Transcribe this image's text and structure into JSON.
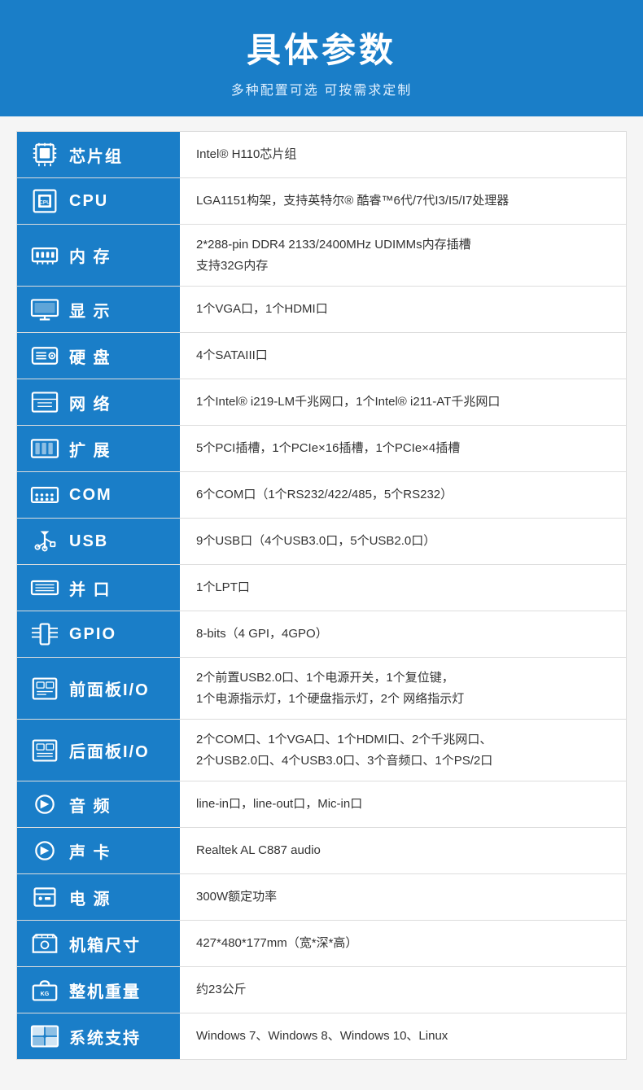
{
  "header": {
    "title": "具体参数",
    "subtitle": "多种配置可选 可按需求定制"
  },
  "rows": [
    {
      "id": "chipset",
      "icon": "chipset",
      "label": "芯片组",
      "value": "Intel® H110芯片组"
    },
    {
      "id": "cpu",
      "icon": "cpu",
      "label": "CPU",
      "value": "LGA1151构架，支持英特尔® 酷睿™6代/7代I3/I5/I7处理器"
    },
    {
      "id": "memory",
      "icon": "memory",
      "label": "内 存",
      "value": "2*288-pin DDR4 2133/2400MHz UDIMMs内存插槽\n支持32G内存"
    },
    {
      "id": "display",
      "icon": "display",
      "label": "显 示",
      "value": "1个VGA口，1个HDMI口"
    },
    {
      "id": "hdd",
      "icon": "hdd",
      "label": "硬 盘",
      "value": "4个SATAIII口"
    },
    {
      "id": "network",
      "icon": "network",
      "label": "网 络",
      "value": "1个Intel® i219-LM千兆网口，1个Intel® i211-AT千兆网口"
    },
    {
      "id": "expansion",
      "icon": "expansion",
      "label": "扩 展",
      "value": "5个PCI插槽，1个PCIe×16插槽，1个PCIe×4插槽"
    },
    {
      "id": "com",
      "icon": "com",
      "label": "COM",
      "value": "6个COM口（1个RS232/422/485，5个RS232）"
    },
    {
      "id": "usb",
      "icon": "usb",
      "label": "USB",
      "value": "9个USB口（4个USB3.0口，5个USB2.0口）"
    },
    {
      "id": "parallel",
      "icon": "parallel",
      "label": "并 口",
      "value": "1个LPT口"
    },
    {
      "id": "gpio",
      "icon": "gpio",
      "label": "GPIO",
      "value": "8-bits（4 GPI，4GPO）"
    },
    {
      "id": "frontio",
      "icon": "frontio",
      "label": "前面板I/O",
      "value": "2个前置USB2.0口、1个电源开关，1个复位键，\n1个电源指示灯，1个硬盘指示灯，2个 网络指示灯"
    },
    {
      "id": "reario",
      "icon": "reario",
      "label": "后面板I/O",
      "value": "2个COM口、1个VGA口、1个HDMI口、2个千兆网口、\n2个USB2.0口、4个USB3.0口、3个音频口、1个PS/2口"
    },
    {
      "id": "audio",
      "icon": "audio",
      "label": "音 频",
      "value": "line-in口，line-out口，Mic-in口"
    },
    {
      "id": "soundcard",
      "icon": "soundcard",
      "label": "声 卡",
      "value": "Realtek AL C887 audio"
    },
    {
      "id": "power",
      "icon": "power",
      "label": "电 源",
      "value": "300W额定功率"
    },
    {
      "id": "size",
      "icon": "size",
      "label": "机箱尺寸",
      "value": "427*480*177mm（宽*深*高）"
    },
    {
      "id": "weight",
      "icon": "weight",
      "label": "整机重量",
      "value": "约23公斤"
    },
    {
      "id": "os",
      "icon": "os",
      "label": "系统支持",
      "value": "Windows 7、Windows 8、Windows 10、Linux"
    }
  ]
}
